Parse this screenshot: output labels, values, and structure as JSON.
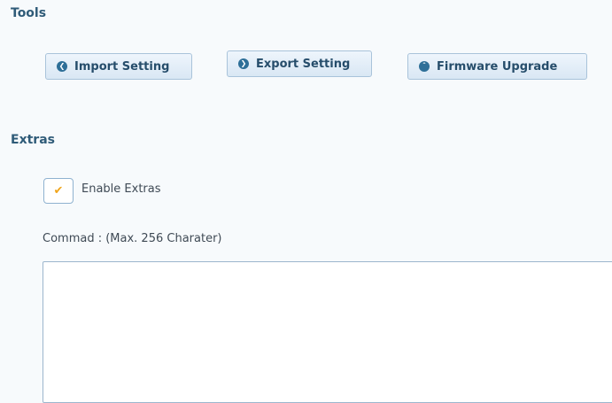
{
  "tools": {
    "title": "Tools",
    "buttons": [
      {
        "label": "Import Setting",
        "icon": "arrow-left-icon"
      },
      {
        "label": "Export Setting",
        "icon": "arrow-right-icon"
      },
      {
        "label": "Firmware Upgrade",
        "icon": "arrow-up-icon"
      }
    ]
  },
  "extras": {
    "title": "Extras",
    "enable_label": "Enable Extras",
    "enable_checked": true,
    "command_label": "Commad : (Max. 256 Charater)",
    "command_value": ""
  },
  "colors": {
    "accent": "#2e6f98",
    "check": "#f0a51c",
    "title": "#2f5b78"
  }
}
